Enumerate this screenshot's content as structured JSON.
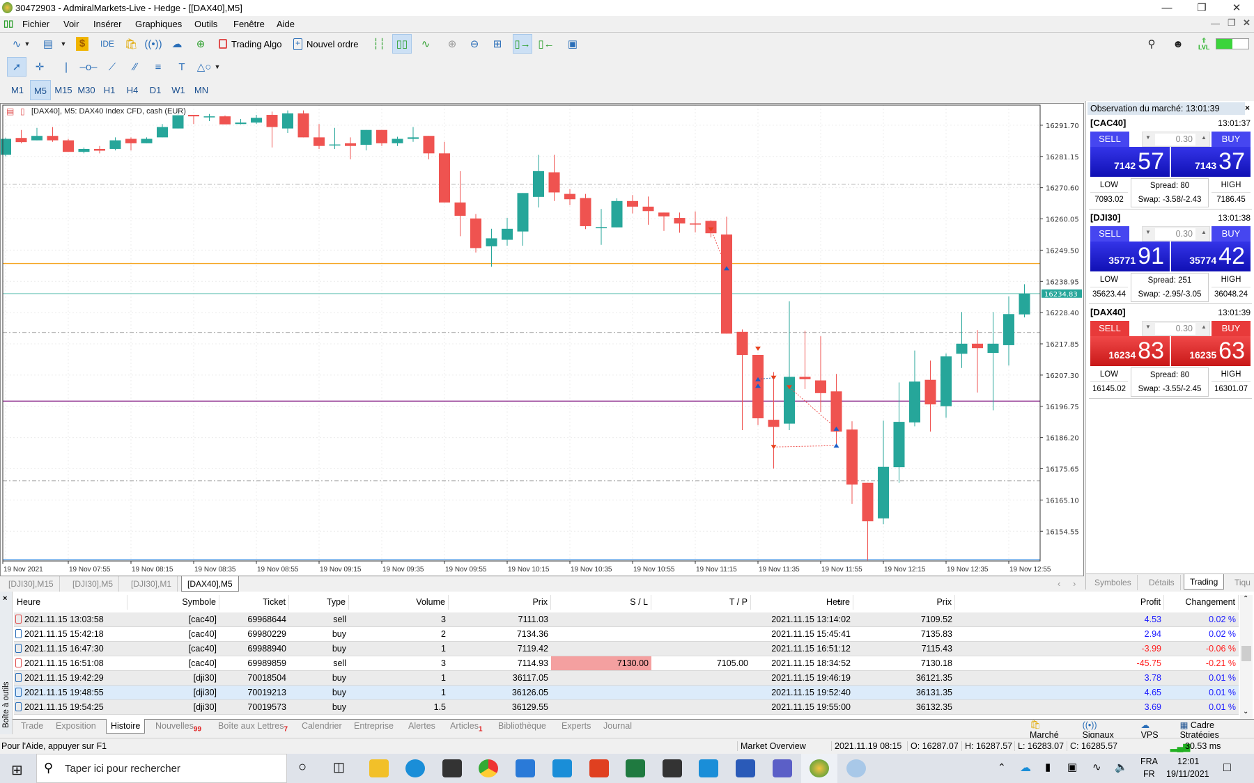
{
  "window": {
    "title": "30472903 - AdmiralMarkets-Live - Hedge - [[DAX40],M5]"
  },
  "menu": [
    "Fichier",
    "Voir",
    "Insérer",
    "Graphiques",
    "Outils",
    "Fenêtre",
    "Aide"
  ],
  "toolbar": {
    "trading_algo": "Trading Algo",
    "new_order": "Nouvel ordre",
    "ide": "IDE",
    "lvl": "LVL"
  },
  "timeframes": [
    "M1",
    "M5",
    "M15",
    "M30",
    "H1",
    "H4",
    "D1",
    "W1",
    "MN"
  ],
  "active_timeframe": "M5",
  "chart_header": "[DAX40], M5:  DAX40 Index CFD, cash (EUR)",
  "chart_tabs": [
    "[DJI30],M15",
    "[DJI30],M5",
    "[DJI30],M1",
    "[DAX40],M5"
  ],
  "chart_data": {
    "type": "candlestick",
    "symbol": "[DAX40]",
    "timeframe": "M5",
    "ylim": [
      16144.5,
      16298.5
    ],
    "yticks": [
      "16291.70",
      "16281.15",
      "16270.60",
      "16260.05",
      "16249.50",
      "16238.95",
      "16228.40",
      "16217.85",
      "16207.30",
      "16196.75",
      "16186.20",
      "16175.65",
      "16165.10",
      "16154.55"
    ],
    "xticks": [
      "19 Nov 2021",
      "19 Nov 07:55",
      "19 Nov 08:15",
      "19 Nov 08:35",
      "19 Nov 08:55",
      "19 Nov 09:15",
      "19 Nov 09:35",
      "19 Nov 09:55",
      "19 Nov 10:15",
      "19 Nov 10:35",
      "19 Nov 10:55",
      "19 Nov 11:15",
      "19 Nov 11:35",
      "19 Nov 11:55",
      "19 Nov 12:15",
      "19 Nov 12:35",
      "19 Nov 12:55"
    ],
    "current_price": "16234.83",
    "colors": {
      "bull": "#26a69a",
      "bear": "#ef5350"
    },
    "hlines": [
      {
        "price": 16245.0,
        "color": "#f5a623",
        "style": "solid"
      },
      {
        "price": 16234.83,
        "color": "#8fd3c8",
        "style": "solid"
      },
      {
        "price": 16198.5,
        "color": "#8b2a8b",
        "style": "solid"
      },
      {
        "price": 16145.02,
        "color": "#6aa8e8",
        "style": "solid"
      },
      {
        "price": 16271.8,
        "color": "#b8b8b8",
        "style": "dashdot"
      },
      {
        "price": 16221.7,
        "color": "#b8b8b8",
        "style": "dashdot"
      },
      {
        "price": 16171.6,
        "color": "#b8b8b8",
        "style": "dashdot"
      }
    ],
    "ohlc": [
      [
        16281.7,
        16287.5,
        16281.2,
        16287.1
      ],
      [
        16287.4,
        16290.1,
        16285.6,
        16286.0
      ],
      [
        16286.6,
        16290.8,
        16286.6,
        16288.1
      ],
      [
        16288.1,
        16291.1,
        16286.1,
        16286.6
      ],
      [
        16286.6,
        16287.1,
        16282.7,
        16282.7
      ],
      [
        16282.7,
        16284.2,
        16282.2,
        16283.7
      ],
      [
        16283.7,
        16284.7,
        16282.2,
        16283.1
      ],
      [
        16283.7,
        16287.6,
        16283.2,
        16286.6
      ],
      [
        16287.1,
        16287.6,
        16283.2,
        16285.6
      ],
      [
        16285.6,
        16287.6,
        16285.6,
        16287.1
      ],
      [
        16287.6,
        16292.1,
        16287.6,
        16291.1
      ],
      [
        16290.6,
        16296.3,
        16290.6,
        16295.2
      ],
      [
        16295.2,
        16295.2,
        16292.1,
        16294.7
      ],
      [
        16294.6,
        16295.5,
        16293.1,
        16294.7
      ],
      [
        16294.7,
        16295.0,
        16292.0,
        16292.0
      ],
      [
        16292.1,
        16293.8,
        16292.0,
        16292.6
      ],
      [
        16292.6,
        16295.2,
        16292.1,
        16294.2
      ],
      [
        16295.2,
        16296.3,
        16284.2,
        16291.1
      ],
      [
        16290.6,
        16296.7,
        16289.1,
        16295.7
      ],
      [
        16295.7,
        16296.7,
        16287.6,
        16287.6
      ],
      [
        16287.6,
        16292.1,
        16283.7,
        16284.7
      ],
      [
        16285.1,
        16290.8,
        16283.7,
        16285.2
      ],
      [
        16285.6,
        16287.6,
        16280.2,
        16284.7
      ],
      [
        16285.1,
        16290.1,
        16283.2,
        16290.1
      ],
      [
        16290.1,
        16290.1,
        16284.7,
        16285.6
      ],
      [
        16285.6,
        16287.8,
        16284.7,
        16287.1
      ],
      [
        16287.1,
        16291.1,
        16286.1,
        16287.6
      ],
      [
        16288.1,
        16288.1,
        16280.2,
        16282.2
      ],
      [
        16282.2,
        16286.1,
        16265.6,
        16265.6
      ],
      [
        16265.6,
        16276.2,
        16254.2,
        16261.1
      ],
      [
        16260.2,
        16261.7,
        16248.7,
        16250.2
      ],
      [
        16250.8,
        16256.7,
        16243.9,
        16253.5
      ],
      [
        16253.0,
        16260.4,
        16251.0,
        16256.7
      ],
      [
        16255.8,
        16268.8,
        16251.0,
        16268.8
      ],
      [
        16267.5,
        16281.7,
        16263.9,
        16276.2
      ],
      [
        16275.8,
        16281.7,
        16266.1,
        16269.0
      ],
      [
        16268.5,
        16270.1,
        16264.7,
        16266.7
      ],
      [
        16267.1,
        16268.5,
        16256.6,
        16257.6
      ],
      [
        16257.1,
        16263.4,
        16251.3,
        16257.3
      ],
      [
        16257.2,
        16267.0,
        16257.2,
        16266.1
      ],
      [
        16266.1,
        16268.1,
        16261.9,
        16264.2
      ],
      [
        16264.2,
        16267.6,
        16258.1,
        16262.7
      ],
      [
        16262.2,
        16262.2,
        16256.0,
        16260.9
      ],
      [
        16260.4,
        16262.2,
        16255.4,
        16258.5
      ],
      [
        16258.5,
        16262.6,
        16255.5,
        16258.3
      ],
      [
        16259.4,
        16259.6,
        16253.8,
        16255.2
      ],
      [
        16254.8,
        16260.8,
        16221.3,
        16221.3
      ],
      [
        16221.9,
        16222.7,
        16188.7,
        16214.1
      ],
      [
        16214.1,
        16214.1,
        16190.4,
        16192.7
      ],
      [
        16192.2,
        16208.3,
        16175.7,
        16189.8
      ],
      [
        16190.9,
        16232.2,
        16188.7,
        16206.7
      ],
      [
        16206.7,
        16222.3,
        16202.6,
        16205.9
      ],
      [
        16205.5,
        16220.4,
        16194.8,
        16201.2
      ],
      [
        16201.8,
        16207.7,
        16183.8,
        16188.2
      ],
      [
        16188.9,
        16191.7,
        16163.8,
        16170.3
      ],
      [
        16170.9,
        16170.9,
        16144.7,
        16157.9
      ],
      [
        16158.9,
        16191.9,
        16156.9,
        16176.3
      ],
      [
        16176.2,
        16204.8,
        16170.9,
        16191.5
      ],
      [
        16191.3,
        16215.6,
        16190.0,
        16205.1
      ],
      [
        16205.7,
        16212.2,
        16188.2,
        16197.4
      ],
      [
        16196.8,
        16214.6,
        16192.9,
        16213.6
      ],
      [
        16214.5,
        16228.6,
        16209.7,
        16217.9
      ],
      [
        16217.9,
        16222.5,
        16201.4,
        16216.4
      ],
      [
        16214.8,
        16228.6,
        16195.4,
        16217.9
      ],
      [
        16217.4,
        16233.9,
        16210.5,
        16227.9
      ],
      [
        16227.8,
        16238.0,
        16226.8,
        16234.8
      ]
    ],
    "trade_markers": [
      {
        "candle": 45,
        "price": 16256.5,
        "side": "sell"
      },
      {
        "candle": 46,
        "price": 16243.4,
        "side": "buy"
      },
      {
        "candle": 48,
        "price": 16216.2,
        "side": "sell"
      },
      {
        "candle": 48,
        "price": 16205.9,
        "side": "buy"
      },
      {
        "candle": 48,
        "price": 16203.7,
        "side": "buy"
      },
      {
        "candle": 49,
        "price": 16206.4,
        "side": "sell"
      },
      {
        "candle": 50,
        "price": 16203.2,
        "side": "sell"
      },
      {
        "candle": 53,
        "price": 16189.2,
        "side": "buy"
      },
      {
        "candle": 49,
        "price": 16183.0,
        "side": "sell"
      },
      {
        "candle": 53,
        "price": 16183.5,
        "side": "buy"
      }
    ],
    "trade_links": [
      {
        "from": 0,
        "to": 1,
        "color": "#ef5350"
      },
      {
        "from": 3,
        "to": 5,
        "color": "#2a6eb8"
      },
      {
        "from": 6,
        "to": 7,
        "color": "#ef5350"
      },
      {
        "from": 8,
        "to": 9,
        "color": "#ef5350"
      }
    ]
  },
  "market_watch": {
    "title": "Observation du marché: 13:01:39",
    "sell_label": "SELL",
    "buy_label": "BUY",
    "low_label": "LOW",
    "high_label": "HIGH",
    "symbols": [
      {
        "name": "[CAC40]",
        "time": "13:01:37",
        "lot": "0.30",
        "bid_main": "7142",
        "bid_big": "57",
        "ask_main": "7143",
        "ask_big": "37",
        "low": "7093.02",
        "high": "7186.45",
        "spread": "Spread: 80",
        "swap": "Swap: -3.58/-2.43",
        "color": "blue"
      },
      {
        "name": "[DJI30]",
        "time": "13:01:38",
        "lot": "0.30",
        "bid_main": "35771",
        "bid_big": "91",
        "ask_main": "35774",
        "ask_big": "42",
        "low": "35623.44",
        "high": "36048.24",
        "spread": "Spread: 251",
        "swap": "Swap: -2.95/-3.05",
        "color": "blue"
      },
      {
        "name": "[DAX40]",
        "time": "13:01:39",
        "lot": "0.30",
        "bid_main": "16234",
        "bid_big": "83",
        "ask_main": "16235",
        "ask_big": "63",
        "low": "16145.02",
        "high": "16301.07",
        "spread": "Spread: 80",
        "swap": "Swap: -3.55/-2.45",
        "color": "red"
      }
    ],
    "tabs": [
      "Symboles",
      "Détails",
      "Trading",
      "Tiqu"
    ],
    "active_tab": "Trading"
  },
  "toolbox": {
    "side_label": "Boîte à outils",
    "columns": [
      "Heure",
      "Symbole",
      "Ticket",
      "Type",
      "Volume",
      "Prix",
      "S / L",
      "T / P",
      "Heure",
      "Prix",
      "Profit",
      "Changement"
    ],
    "rows": [
      {
        "heure": "2021.11.15 13:03:58",
        "symbole": "[cac40]",
        "ticket": "69968644",
        "type": "sell",
        "volume": "3",
        "prix": "7111.03",
        "sl": "",
        "tp": "",
        "heure2": "2021.11.15 13:14:02",
        "prix2": "7109.52",
        "profit": "4.53",
        "changement": "0.02 %"
      },
      {
        "heure": "2021.11.15 15:42:18",
        "symbole": "[cac40]",
        "ticket": "69980229",
        "type": "buy",
        "volume": "2",
        "prix": "7134.36",
        "sl": "",
        "tp": "",
        "heure2": "2021.11.15 15:45:41",
        "prix2": "7135.83",
        "profit": "2.94",
        "changement": "0.02 %"
      },
      {
        "heure": "2021.11.15 16:47:30",
        "symbole": "[cac40]",
        "ticket": "69988940",
        "type": "buy",
        "volume": "1",
        "prix": "7119.42",
        "sl": "",
        "tp": "",
        "heure2": "2021.11.15 16:51:12",
        "prix2": "7115.43",
        "profit": "-3.99",
        "changement": "-0.06 %"
      },
      {
        "heure": "2021.11.15 16:51:08",
        "symbole": "[cac40]",
        "ticket": "69989859",
        "type": "sell",
        "volume": "3",
        "prix": "7114.93",
        "sl": "7130.00",
        "tp": "7105.00",
        "heure2": "2021.11.15 18:34:52",
        "prix2": "7130.18",
        "profit": "-45.75",
        "changement": "-0.21 %"
      },
      {
        "heure": "2021.11.15 19:42:29",
        "symbole": "[dji30]",
        "ticket": "70018504",
        "type": "buy",
        "volume": "1",
        "prix": "36117.05",
        "sl": "",
        "tp": "",
        "heure2": "2021.11.15 19:46:19",
        "prix2": "36121.35",
        "profit": "3.78",
        "changement": "0.01 %"
      },
      {
        "heure": "2021.11.15 19:48:55",
        "symbole": "[dji30]",
        "ticket": "70019213",
        "type": "buy",
        "volume": "1",
        "prix": "36126.05",
        "sl": "",
        "tp": "",
        "heure2": "2021.11.15 19:52:40",
        "prix2": "36131.35",
        "profit": "4.65",
        "changement": "0.01 %"
      },
      {
        "heure": "2021.11.15 19:54:25",
        "symbole": "[dji30]",
        "ticket": "70019573",
        "type": "buy",
        "volume": "1.5",
        "prix": "36129.55",
        "sl": "",
        "tp": "",
        "heure2": "2021.11.15 19:55:00",
        "prix2": "36132.35",
        "profit": "3.69",
        "changement": "0.01 %"
      }
    ],
    "tabs": [
      {
        "label": "Trade",
        "badge": ""
      },
      {
        "label": "Exposition",
        "badge": ""
      },
      {
        "label": "Histoire",
        "badge": ""
      },
      {
        "label": "Nouvelles",
        "badge": "99"
      },
      {
        "label": "Boîte aux Lettres",
        "badge": "7"
      },
      {
        "label": "Calendrier",
        "badge": ""
      },
      {
        "label": "Entreprise",
        "badge": ""
      },
      {
        "label": "Alertes",
        "badge": ""
      },
      {
        "label": "Articles",
        "badge": "1"
      },
      {
        "label": "Bibliothèque",
        "badge": ""
      },
      {
        "label": "Experts",
        "badge": ""
      },
      {
        "label": "Journal",
        "badge": ""
      }
    ],
    "active_tab": "Histoire",
    "right_links": [
      "Marché",
      "Signaux",
      "VPS",
      "Cadre Stratégies"
    ]
  },
  "status": {
    "help": "Pour l'Aide, appuyer sur F1",
    "profile": "Market Overview",
    "datetime": "2021.11.19 08:15",
    "open": "O: 16287.07",
    "high": "H: 16287.57",
    "low": "L: 16283.07",
    "close": "C: 16285.57",
    "ping": "30.53 ms"
  },
  "taskbar": {
    "search_placeholder": "Taper ici pour rechercher",
    "lang1": "FRA",
    "lang2": "FR",
    "time": "12:01",
    "date": "19/11/2021"
  }
}
